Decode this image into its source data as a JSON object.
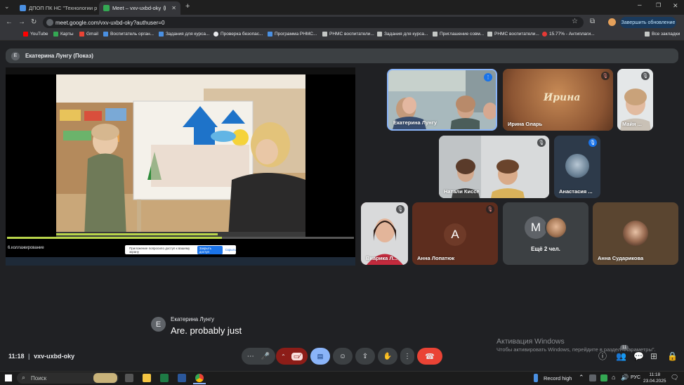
{
  "browser": {
    "tabs": [
      {
        "label": "ДПОП ПК НС \"Технологии ра",
        "active": false
      },
      {
        "label": "Meet – vxv-uxbd-oky",
        "active": true
      }
    ],
    "url": "meet.google.com/vxv-uxbd-oky?authuser=0",
    "update_label": "Завершить обновление",
    "bookmarks": [
      "YouTube",
      "Карты",
      "Gmail",
      "Воспитатель орган...",
      "Задания для курса...",
      "Проверка безопас...",
      "Программа РНМС...",
      "РНМС воспитатели...",
      "Задания для курса...",
      "Приглашение совм...",
      "РНМС воспитатели...",
      "15.77% - Антиплаги..."
    ],
    "all_bookmarks": "Все закладки"
  },
  "meet": {
    "presenter_initial": "Е",
    "presenter_label": "Екатерина Лунгу (Показ)",
    "screen_caption": "6.коллажирование",
    "screen_notice": "Приложение попросило доступ к вашему экрану",
    "screen_notice_btn": "Закрыть доступ",
    "screen_notice_btn2": "Скрыть",
    "participants": [
      {
        "name": "Екатерина Лунгу",
        "muted": false,
        "speaking": true
      },
      {
        "name": "Ирина Оларь",
        "muted": true,
        "overlay": "Ирина"
      },
      {
        "name": "Майя ...",
        "muted": false
      },
      {
        "name": "Натали Киссе",
        "muted": false
      },
      {
        "name": "Анастасия ...",
        "muted": false
      },
      {
        "name": "Виарика Л...",
        "muted": false
      },
      {
        "name": "Анна Лопатюк",
        "muted": true,
        "initial": "А"
      },
      {
        "name": "Ещё 2 чел.",
        "initial": "М"
      },
      {
        "name": "Анна Сударикова",
        "muted": false
      }
    ],
    "caption": {
      "speaker": "Екатерина Лунгу",
      "initial": "Е",
      "text": "Are. probably just"
    },
    "time": "11:18",
    "meeting_code": "vxv-uxbd-oky",
    "people_count": "11"
  },
  "windows_watermark": {
    "title": "Активация Windows",
    "subtitle": "Чтобы активировать Windows, перейдите в раздел \"Параметры\"."
  },
  "taskbar": {
    "search": "Поиск",
    "record": "Record high",
    "lang": "РУС",
    "time": "11:18",
    "date": "23.04.2025"
  }
}
